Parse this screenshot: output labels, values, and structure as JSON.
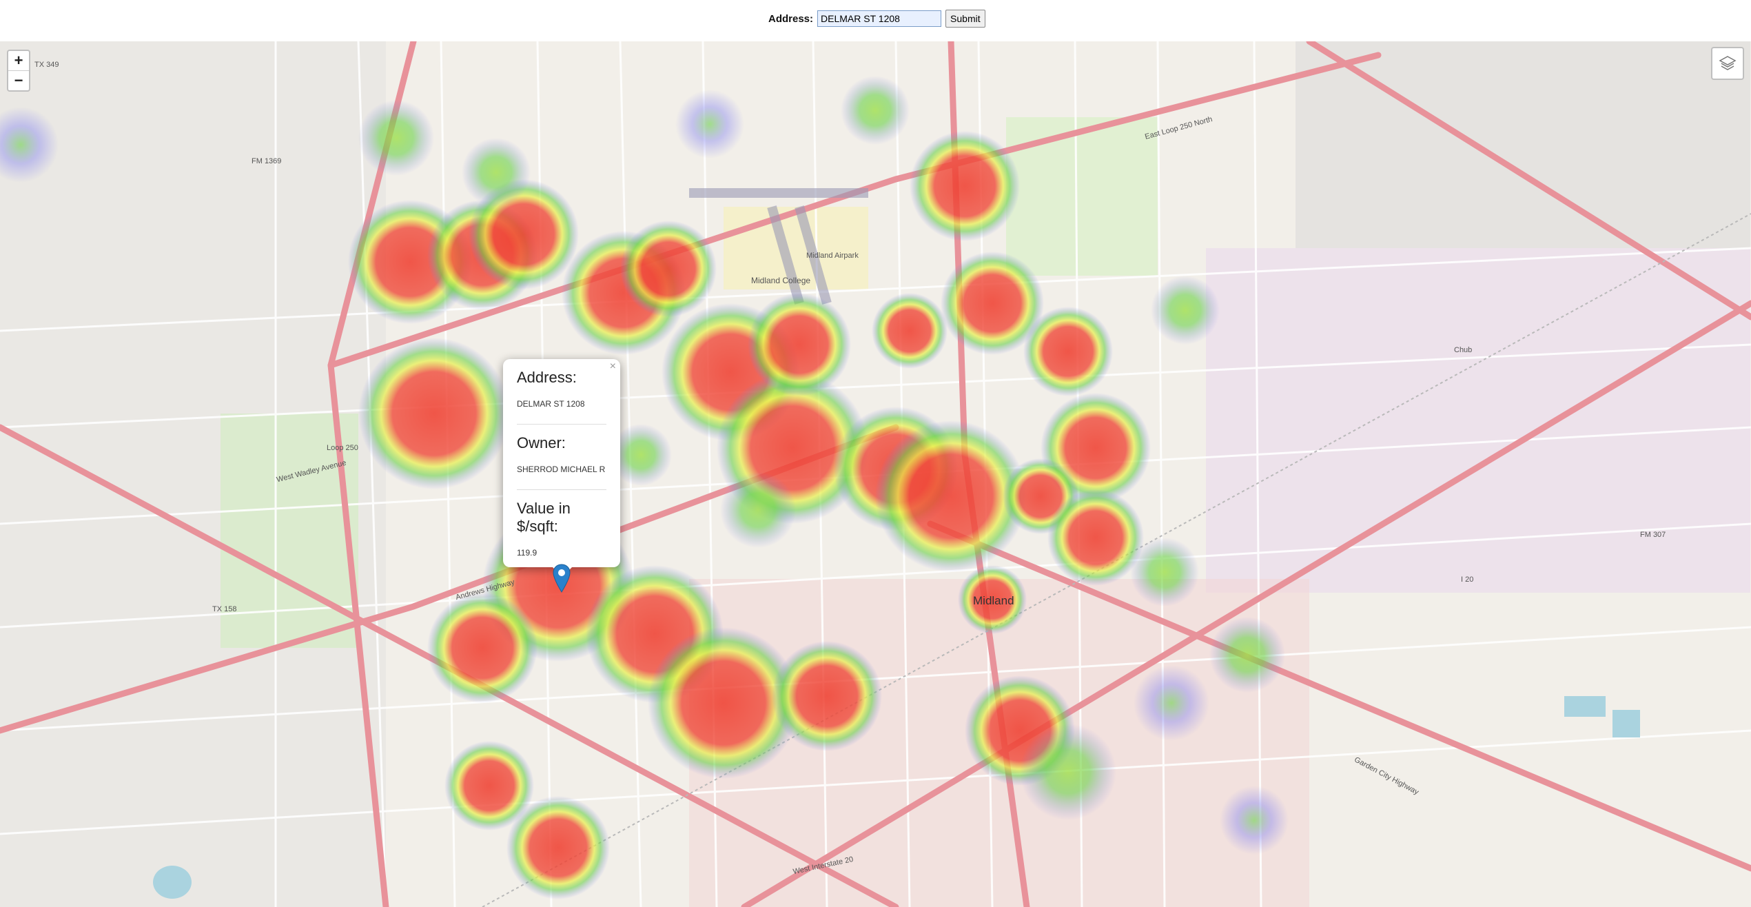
{
  "form": {
    "address_label": "Address:",
    "address_value": "DELMAR ST 1208",
    "submit_label": "Submit"
  },
  "map": {
    "zoom_in": "+",
    "zoom_out": "−",
    "city_label": "Midland",
    "labels": {
      "loop250": "Loop 250",
      "andrews_hwy": "Andrews Highway",
      "w_wadley": "West Wadley Avenue",
      "midland_college": "Midland College",
      "midland_airpark": "Midland Airpark",
      "east_loop_250": "East Loop 250 North",
      "i20": "I 20",
      "garden_city_hwy": "Garden City Highway",
      "w_interstate_20": "West Interstate 20",
      "fm307": "FM 307",
      "tx158": "TX 158",
      "tx349": "TX 349",
      "fm1369": "FM 1369",
      "chub": "Chub"
    }
  },
  "popup": {
    "close": "×",
    "address_title": "Address:",
    "address": "DELMAR ST 1208",
    "owner_title": "Owner:",
    "owner": "SHERROD MICHAEL R",
    "value_title": "Value in $/sqft:",
    "value": "119.9"
  },
  "colors": {
    "heat_red": "#ef3b2c",
    "heat_yellow": "#e8f04a",
    "heat_green": "#6bd14a",
    "heat_blue": "#7a7af0",
    "marker": "#2a81cb",
    "road_major": "#e8929a"
  }
}
